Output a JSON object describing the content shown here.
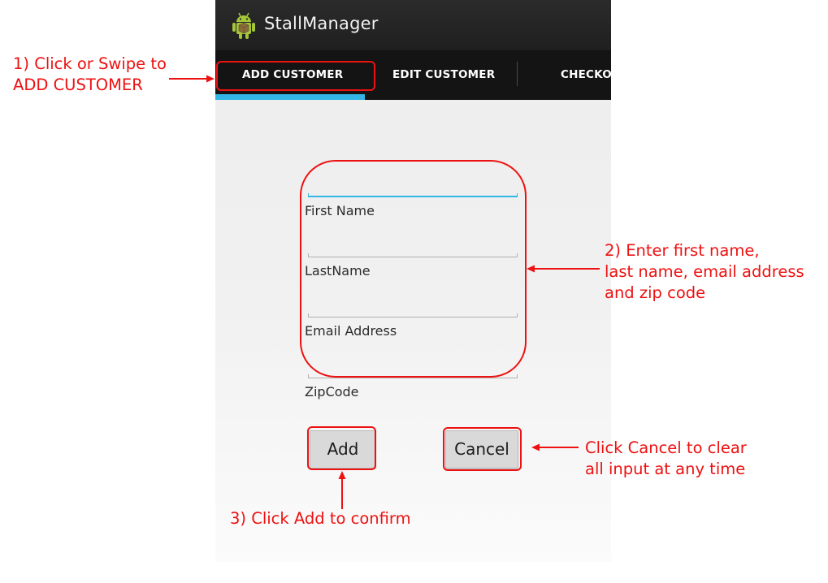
{
  "app": {
    "title": "StallManager",
    "icon": "android-robot-icon"
  },
  "tabs": [
    {
      "label": "ADD CUSTOMER",
      "selected": true
    },
    {
      "label": "EDIT CUSTOMER",
      "selected": false
    },
    {
      "label": "CHECKOUT",
      "selected": false
    }
  ],
  "form": {
    "fields": [
      {
        "label": "First Name",
        "value": "",
        "focused": true
      },
      {
        "label": "LastName",
        "value": "",
        "focused": false
      },
      {
        "label": "Email Address",
        "value": "",
        "focused": false
      },
      {
        "label": "ZipCode",
        "value": "",
        "focused": false
      }
    ],
    "add_label": "Add",
    "cancel_label": "Cancel"
  },
  "annotations": {
    "step1": [
      "1) Click or Swipe to",
      "ADD CUSTOMER"
    ],
    "step2": [
      "2) Enter first name,",
      "last name, email address",
      "and zip code"
    ],
    "step3": "3) Click Add to confirm",
    "cancel_note": [
      "Click Cancel to clear",
      "all input at any time"
    ]
  },
  "colors": {
    "annotation": "#ee1111",
    "accent": "#33b5e5",
    "action_bar": "#222222",
    "tab_bar": "#141414"
  }
}
